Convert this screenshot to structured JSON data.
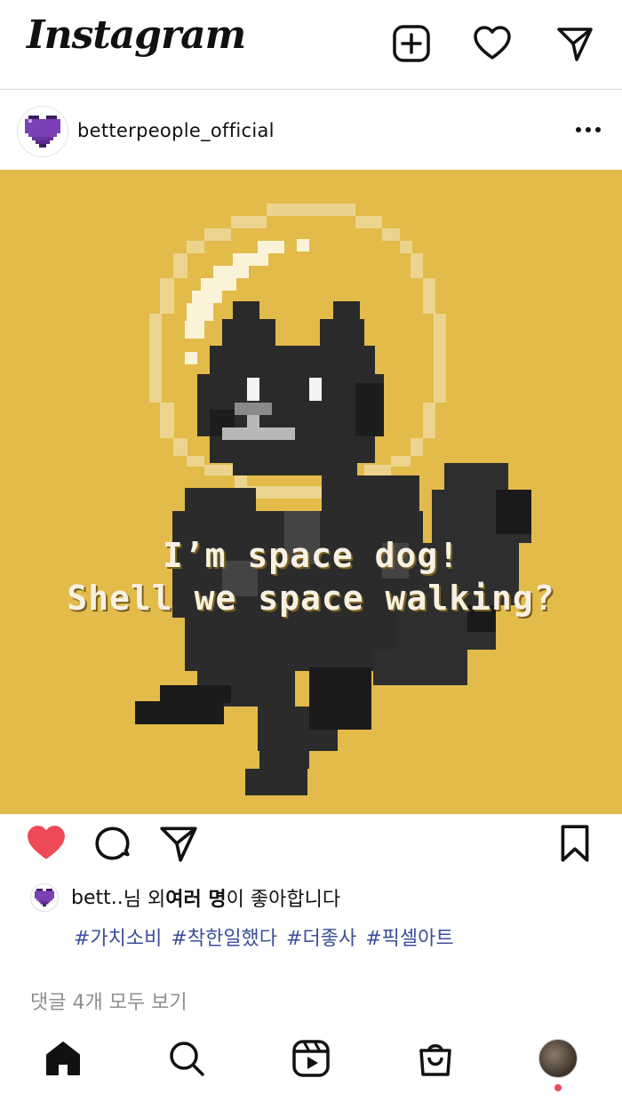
{
  "app": {
    "logo_text": "Instagram"
  },
  "header": {
    "icons": [
      "new-post-icon",
      "heart-icon",
      "direct-message-icon"
    ]
  },
  "post": {
    "username": "betterpeople_official",
    "image_text": {
      "line1": "I’m space dog!",
      "line2": "Shell we space walking?"
    },
    "liked": true,
    "like_color": "#ed4956",
    "likes": {
      "prefix": "bett..",
      "middle": "님 외 ",
      "bold": "여러 명",
      "suffix": "이 좋아합니다"
    },
    "hashtags": [
      "#가치소비",
      "#착한일했다",
      "#더좋사",
      "#픽셀아트"
    ],
    "comments_link": "댓글 4개 모두 보기"
  },
  "colors": {
    "background_yellow": "#e2bb4a",
    "hashtag_blue": "#3b4f9a",
    "avatar_heart": "#7b3fb6"
  },
  "bottom_nav": {
    "items": [
      "home-icon",
      "search-icon",
      "reels-icon",
      "shop-icon",
      "profile-avatar"
    ],
    "notification_dot": true
  }
}
